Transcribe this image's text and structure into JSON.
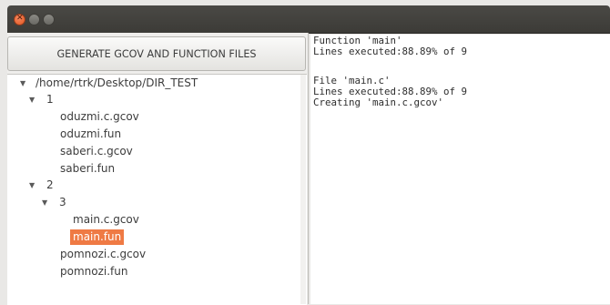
{
  "window": {
    "close_icon": "close-icon",
    "minimize_icon": "minimize-icon",
    "maximize_icon": "maximize-icon"
  },
  "toolbar": {
    "generate_label": "GENERATE GCOV AND FUNCTION FILES"
  },
  "tree": {
    "root": "/home/rtrk/Desktop/DIR_TEST",
    "folder_1": "1",
    "files_1": [
      "oduzmi.c.gcov",
      "oduzmi.fun",
      "saberi.c.gcov",
      "saberi.fun"
    ],
    "folder_2": "2",
    "folder_3": "3",
    "files_3": [
      "main.c.gcov",
      "main.fun"
    ],
    "files_2": [
      "pomnozi.c.gcov",
      "pomnozi.fun"
    ],
    "selected": "main.fun"
  },
  "output": {
    "lines": [
      "Function 'main'",
      "Lines executed:88.89% of 9",
      "",
      "File 'main.c'",
      "Lines executed:88.89% of 9",
      "Creating 'main.c.gcov'"
    ]
  },
  "colors": {
    "selection": "#ef7a44",
    "titlebar": "#3c3b37"
  }
}
